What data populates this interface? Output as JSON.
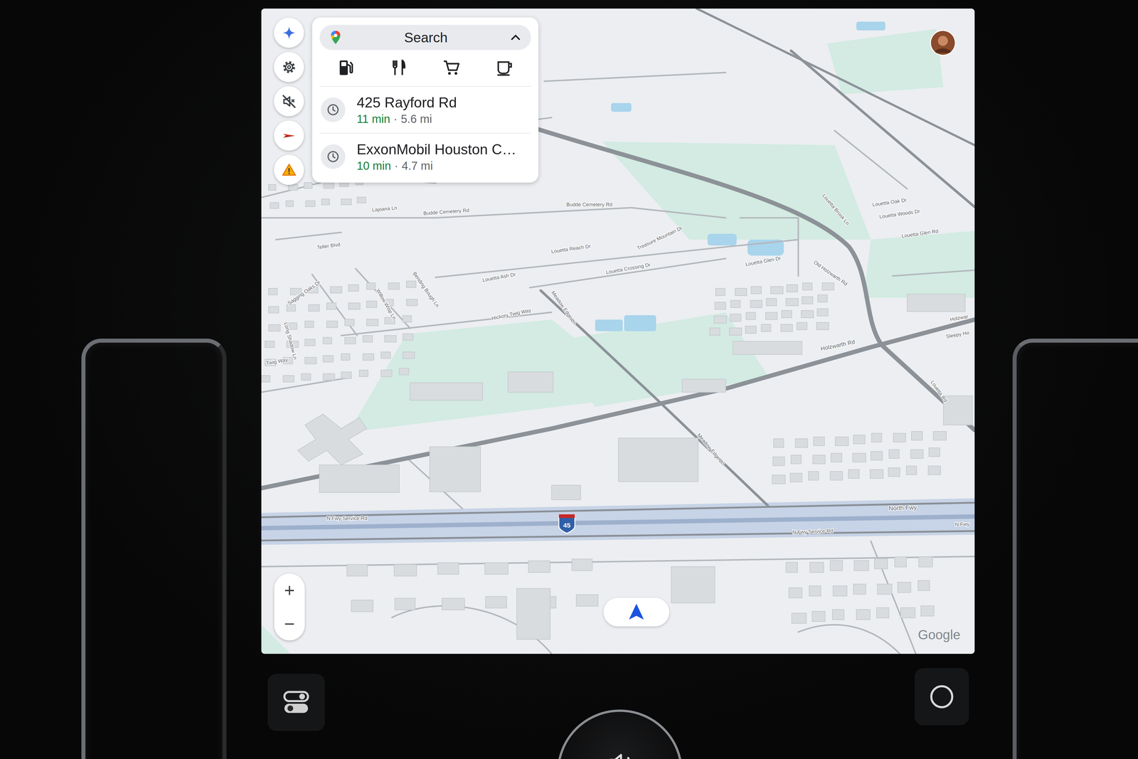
{
  "search": {
    "label": "Search",
    "expanded": true
  },
  "recents": [
    {
      "title": "425 Rayford Rd",
      "time": "11 min",
      "separator": "·",
      "distance": "5.6 mi"
    },
    {
      "title": "ExxonMobil Houston C…",
      "time": "10 min",
      "separator": "·",
      "distance": "4.7 mi"
    }
  ],
  "sound": {
    "muted": true
  },
  "zoom": {
    "in": "+",
    "out": "−"
  },
  "map": {
    "labels": [
      "Budde Cemetery Rd",
      "Budde Cemetery Rd",
      "Louetta Reach Dr",
      "Louetta Ash Dr",
      "Louetta Crossing Dr",
      "Treasure Mountain Dr",
      "Louetta Glen Dr",
      "Old Holzwarth Rd",
      "Holzwarth Rd",
      "Hickory Twig Way",
      "Meadow Edge Ln",
      "Meadow Edge Ln",
      "Willow Wisp Ln",
      "Bending Bough Ln",
      "Sagging Oaks Dr",
      "Twig Way",
      "Teller Blvd",
      "N Fwy Service Rd",
      "N Fwy Service Rd",
      "North Fwy",
      "N Fwy",
      "Louetta Rd",
      "Louetta Glen Rd",
      "Louetta Oak Dr",
      "Louetta Woods Dr",
      "Louetta Brook Ln",
      "Sleepy Ho",
      "Holzwar",
      "Long Shadow Ln",
      "Lajoana Ln"
    ],
    "shield": "45",
    "attribution": "Google"
  }
}
